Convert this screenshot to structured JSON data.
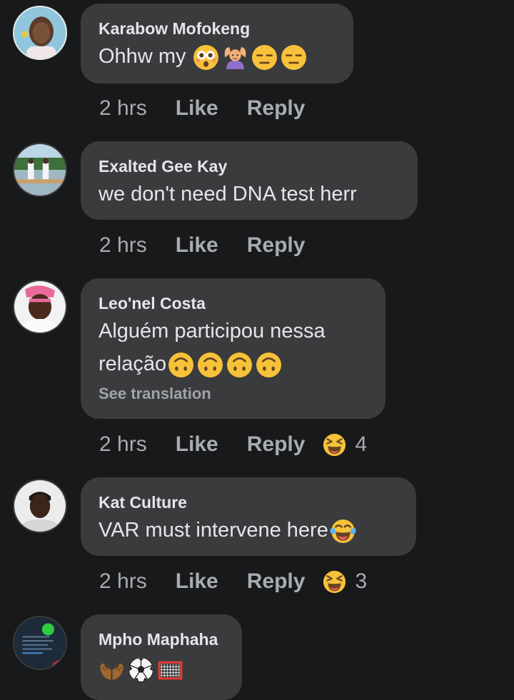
{
  "comments": [
    {
      "author": "Karabow Mofokeng",
      "text": "Ohhw my",
      "emojis": [
        "flushed-face",
        "person-gesturing-ok",
        "expressionless-face",
        "expressionless-face"
      ],
      "time": "2 hrs",
      "like_label": "Like",
      "reply_label": "Reply"
    },
    {
      "author": "Exalted Gee Kay",
      "text": "we don't need DNA test herr",
      "time": "2 hrs",
      "like_label": "Like",
      "reply_label": "Reply"
    },
    {
      "author": "Leo'nel Costa",
      "text_line1": "Alguém participou nessa",
      "text_line2": "relação",
      "emojis": [
        "upside-down-face",
        "upside-down-face",
        "upside-down-face",
        "upside-down-face"
      ],
      "translation_label": "See translation",
      "time": "2 hrs",
      "like_label": "Like",
      "reply_label": "Reply",
      "reaction_icon": "laughing-squinting-face",
      "reaction_count": "4"
    },
    {
      "author": "Kat Culture",
      "text": "VAR must intervene here",
      "emojis": [
        "face-with-tears-of-joy"
      ],
      "time": "2 hrs",
      "like_label": "Like",
      "reply_label": "Reply",
      "reaction_icon": "laughing-squinting-face",
      "reaction_count": "3"
    },
    {
      "author": "Mpho Maphaha",
      "emojis": [
        "palms-up-together",
        "soccer-ball",
        "goal-net"
      ]
    }
  ],
  "colors": {
    "background": "#18191a",
    "bubble": "#3a3b3c",
    "text": "#e4e6eb",
    "secondary": "#a8abaf"
  }
}
